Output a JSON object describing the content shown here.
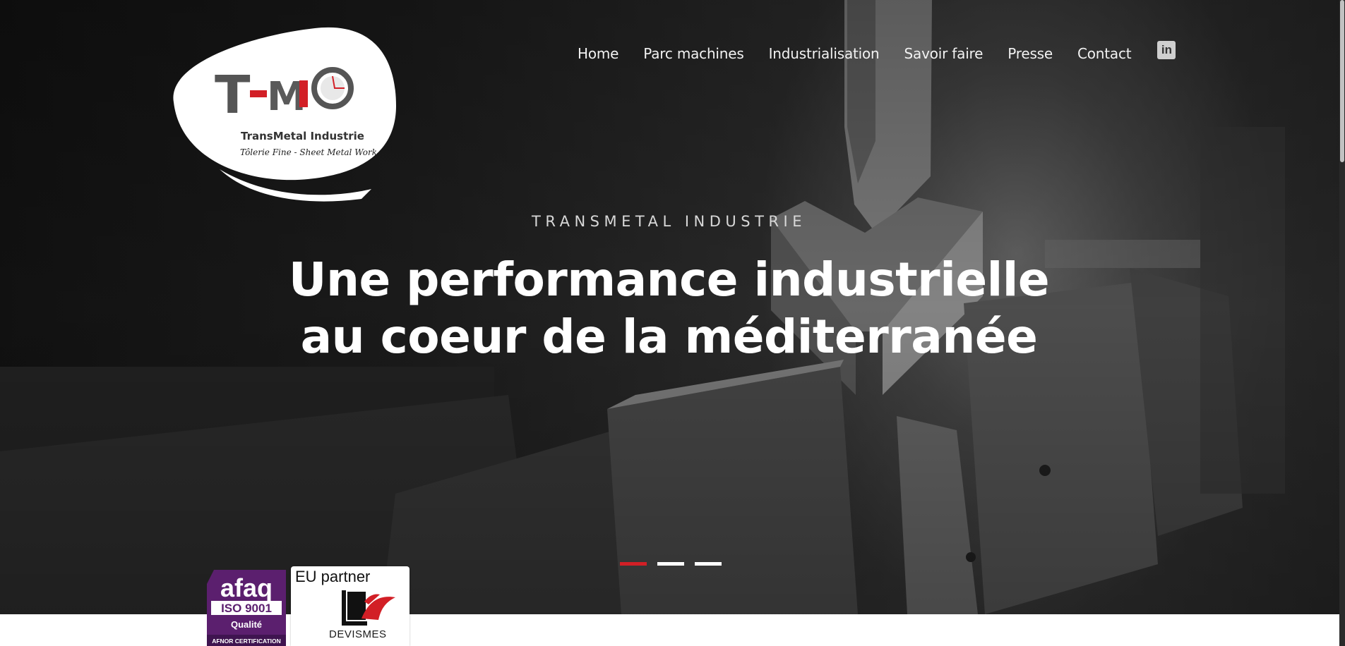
{
  "nav": {
    "items": [
      {
        "label": "Home"
      },
      {
        "label": "Parc machines"
      },
      {
        "label": "Industrialisation"
      },
      {
        "label": "Savoir faire"
      },
      {
        "label": "Presse"
      },
      {
        "label": "Contact"
      }
    ],
    "linkedin_icon": "linkedin-icon",
    "linkedin_glyph": "in"
  },
  "logo": {
    "mark": "T-MIO",
    "company": "TransMetal Industrie",
    "tagline": "Tôlerie Fine - Sheet Metal Work"
  },
  "hero": {
    "kicker": "TRANSMETAL INDUSTRIE",
    "headline_line1": "Une performance industrielle",
    "headline_line2": "au coeur de la méditerranée",
    "slides": {
      "count": 3,
      "active": 1
    }
  },
  "badges": {
    "afaq": {
      "brand": "afaq",
      "standard": "ISO 9001",
      "grade": "Qualité",
      "issuer": "AFNOR CERTIFICATION"
    },
    "eu_partner": {
      "title": "EU partner",
      "company": "DEVISMES"
    }
  },
  "colors": {
    "accent": "#d21f26",
    "afaq_purple": "#5b1f6e",
    "hero_dark": "#1f1f1f"
  }
}
